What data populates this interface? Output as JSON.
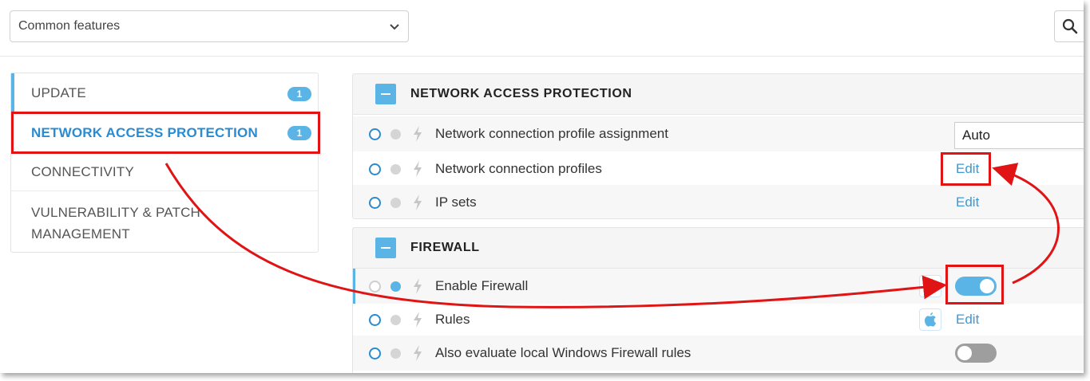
{
  "topbar": {
    "select_value": "Common features"
  },
  "sidebar": {
    "items": [
      {
        "label": "UPDATE",
        "badge": "1"
      },
      {
        "label": "NETWORK ACCESS PROTECTION",
        "badge": "1"
      },
      {
        "label": "CONNECTIVITY"
      },
      {
        "label_line1": "VULNERABILITY & PATCH",
        "label_line2": "MANAGEMENT"
      }
    ]
  },
  "sections": {
    "nap": {
      "title": "NETWORK ACCESS PROTECTION",
      "rows": [
        {
          "label": "Network connection profile assignment",
          "value": "Auto"
        },
        {
          "label": "Network connection profiles",
          "action": "Edit"
        },
        {
          "label": "IP sets",
          "action": "Edit"
        }
      ]
    },
    "firewall": {
      "title": "FIREWALL",
      "rows": [
        {
          "label": "Enable Firewall",
          "toggle": "on"
        },
        {
          "label": "Rules",
          "action": "Edit"
        },
        {
          "label": "Also evaluate local Windows Firewall rules",
          "toggle": "off"
        }
      ]
    }
  },
  "colors": {
    "accent": "#5ab4e5",
    "link": "#3a9ad9",
    "selected_text": "#2b8bd0",
    "annotation": "#e01414"
  }
}
